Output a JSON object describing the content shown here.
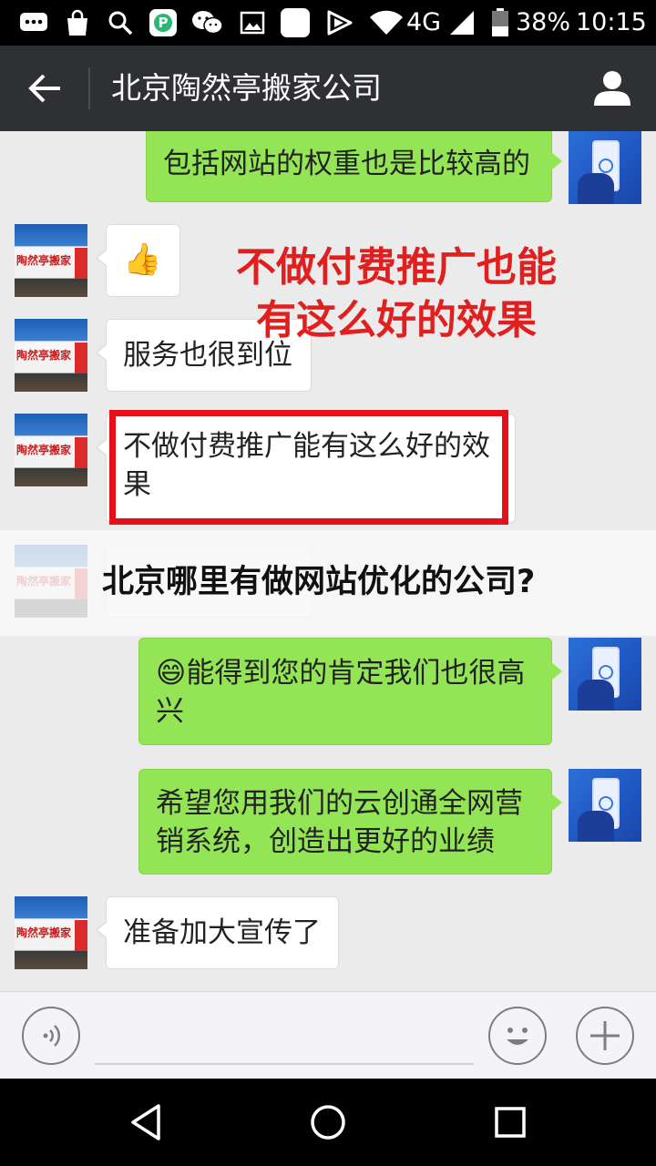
{
  "status_bar": {
    "network": "4G",
    "battery": "38%",
    "time": "10:15",
    "icons": [
      "message-icon",
      "shopping-bag-icon",
      "search-icon",
      "parking-app-icon",
      "wechat-icon",
      "image-icon",
      "blank-app-icon",
      "play-icon",
      "wifi-icon",
      "signal-icon",
      "battery-icon"
    ]
  },
  "header": {
    "title": "北京陶然亭搬家公司",
    "icons": [
      "back-arrow-icon",
      "person-icon"
    ]
  },
  "chat": {
    "messages": [
      {
        "side": "right",
        "avatar": "phone-fingerprint-avatar",
        "text": "包括网站的权重也是比较高的"
      },
      {
        "side": "left",
        "avatar": "brand-avatar",
        "emoji": "👍",
        "emoji_name": "thumbs-up-icon"
      },
      {
        "side": "left",
        "avatar": "brand-avatar",
        "text": "服务也很到位"
      },
      {
        "side": "left",
        "avatar": "brand-avatar",
        "text": "不做付费推广能有这么好的效果"
      },
      {
        "side": "left",
        "avatar": "brand-avatar",
        "text": ""
      },
      {
        "side": "right",
        "avatar": "phone-fingerprint-avatar",
        "emoji": "😄",
        "text": "能得到您的肯定我们也很高兴"
      },
      {
        "side": "right",
        "avatar": "phone-fingerprint-avatar",
        "text": "希望您用我们的云创通全网营销系统，创造出更好的业绩"
      },
      {
        "side": "left",
        "avatar": "brand-avatar",
        "text": "准备加大宣传了"
      }
    ],
    "avatar_brand_text": "陶然亭搬家"
  },
  "overlay": {
    "red_caption_line1": "不做付费推广也能",
    "red_caption_line2": "有这么好的效果",
    "banner_text": "北京哪里有做网站优化的公司?",
    "colors": {
      "red": "#e01f1f",
      "box": "#e5101a"
    }
  },
  "input_bar": {
    "icons": [
      "voice-icon",
      "emoji-face-icon",
      "plus-icon"
    ]
  },
  "nav_bar": {
    "icons": [
      "nav-back-icon",
      "nav-home-icon",
      "nav-recents-icon"
    ]
  },
  "colors": {
    "app_bar": "#2e3033",
    "chat_bg": "#ebebeb",
    "bubble_right": "#94e556",
    "bubble_left": "#ffffff"
  }
}
